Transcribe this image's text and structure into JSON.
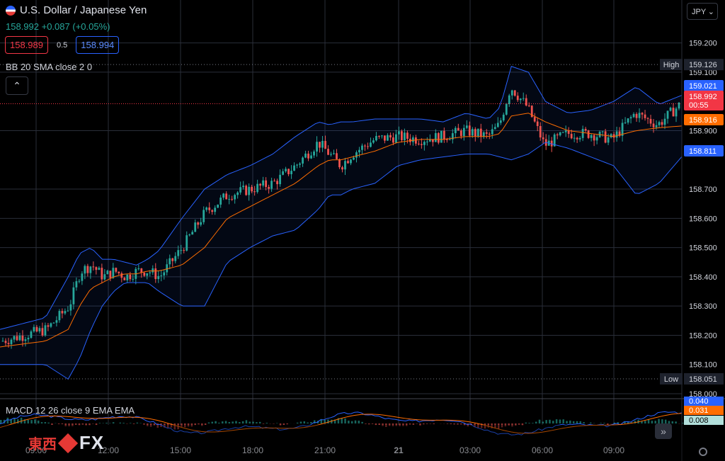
{
  "header": {
    "symbol_title": "U.S. Dollar / Japanese Yen",
    "last": "158.992",
    "change": "+0.087 (+0.05%)",
    "bid": "158.989",
    "spread": "0.5",
    "ask": "158.994",
    "currency": "JPY",
    "flag_icon": "us-flag-icon"
  },
  "indicators": {
    "bb_label": "BB 20 SMA close 2 0",
    "macd_label": "MACD 12 26 close 9 EMA EMA"
  },
  "branding": {
    "cn": "東西",
    "fx": "FX"
  },
  "colors": {
    "up": "#26a69a",
    "down": "#ef5350",
    "bb_band": "#2962ff",
    "bb_basis": "#ff6d00",
    "grid": "#2a2e39",
    "bg": "#000000"
  },
  "chart_data": [
    {
      "type": "candlestick",
      "indicator": "Bollinger Bands (20, 2)",
      "ylim": [
        158.0,
        159.25
      ],
      "yticks": [
        "159.200",
        "159.100",
        "158.900",
        "158.700",
        "158.600",
        "158.500",
        "158.400",
        "158.300",
        "158.200",
        "158.100",
        "158.000"
      ],
      "xticks": [
        "09:00",
        "12:00",
        "15:00",
        "18:00",
        "21:00",
        "21",
        "03:00",
        "06:00",
        "09:00"
      ],
      "high_marker": {
        "label": "High",
        "value": "159.126"
      },
      "low_marker": {
        "label": "Low",
        "value": "158.051"
      },
      "price_labels": [
        {
          "value": "159.021",
          "role": "bb-upper"
        },
        {
          "value": "158.992",
          "role": "last-price"
        },
        {
          "value": "00:55",
          "role": "countdown"
        },
        {
          "value": "158.916",
          "role": "bb-basis"
        },
        {
          "value": "158.811",
          "role": "bb-lower"
        }
      ],
      "path_x": [
        0,
        4,
        8,
        12,
        14,
        16,
        18,
        20,
        22,
        24,
        26,
        28,
        32,
        36,
        40,
        44,
        48,
        52,
        56,
        58,
        60,
        62,
        66,
        70,
        74,
        78,
        82,
        86,
        88,
        90,
        93,
        96,
        100,
        104,
        108,
        112,
        116,
        120
      ],
      "path_y": [
        158.18,
        158.2,
        158.22,
        158.3,
        158.42,
        158.44,
        158.4,
        158.42,
        158.4,
        158.42,
        158.42,
        158.4,
        158.5,
        158.62,
        158.68,
        158.7,
        158.72,
        158.78,
        158.86,
        158.82,
        158.78,
        158.82,
        158.87,
        158.88,
        158.87,
        158.88,
        158.9,
        158.88,
        158.92,
        159.05,
        158.98,
        158.85,
        158.89,
        158.89,
        158.87,
        158.96,
        158.92,
        158.99
      ],
      "basis_y": [
        158.16,
        158.17,
        158.18,
        158.22,
        158.3,
        158.36,
        158.38,
        158.4,
        158.41,
        158.41,
        158.42,
        158.42,
        158.44,
        158.5,
        158.6,
        158.64,
        158.68,
        158.72,
        158.78,
        158.8,
        158.8,
        158.81,
        158.83,
        158.86,
        158.87,
        158.87,
        158.88,
        158.88,
        158.89,
        158.95,
        158.96,
        158.93,
        158.9,
        158.89,
        158.88,
        158.9,
        158.91,
        158.916
      ],
      "upper_y": [
        158.22,
        158.24,
        158.26,
        158.4,
        158.48,
        158.5,
        158.46,
        158.46,
        158.45,
        158.44,
        158.46,
        158.49,
        158.6,
        158.7,
        158.75,
        158.78,
        158.82,
        158.88,
        158.93,
        158.92,
        158.93,
        158.93,
        158.94,
        158.94,
        158.94,
        158.93,
        158.96,
        158.94,
        158.98,
        159.12,
        159.1,
        159.0,
        158.96,
        158.97,
        159.0,
        159.05,
        158.99,
        159.021
      ],
      "lower_y": [
        158.1,
        158.1,
        158.1,
        158.05,
        158.12,
        158.22,
        158.3,
        158.35,
        158.38,
        158.38,
        158.38,
        158.35,
        158.3,
        158.3,
        158.45,
        158.5,
        158.54,
        158.56,
        158.63,
        158.68,
        158.68,
        158.7,
        158.72,
        158.78,
        158.8,
        158.81,
        158.82,
        158.82,
        158.81,
        158.8,
        158.82,
        158.86,
        158.84,
        158.81,
        158.78,
        158.68,
        158.72,
        158.811
      ],
      "n_candles": 240
    },
    {
      "type": "line",
      "indicator": "MACD (12, 26, 9)",
      "ylim": [
        -0.05,
        0.05
      ],
      "values_labels": [
        {
          "value": "0.040",
          "role": "macd"
        },
        {
          "value": "0.031",
          "role": "signal"
        },
        {
          "value": "0.008",
          "role": "histogram"
        }
      ]
    }
  ]
}
